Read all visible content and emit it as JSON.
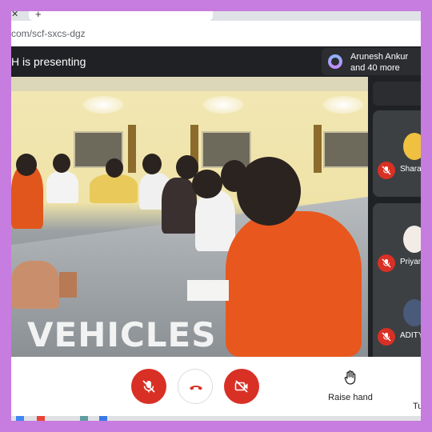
{
  "browser": {
    "url": "com/scf-sxcs-dgz"
  },
  "meet": {
    "presenting_text": "H is presenting",
    "participants_chip": {
      "name": "Arunesh Ankur",
      "more": "and 40 more"
    }
  },
  "presentation": {
    "watermark": "VEHICLES"
  },
  "sidebar": {
    "tiles": [
      {
        "name": "Sharan",
        "muted": true
      },
      {
        "name": "Priyans",
        "muted": true
      },
      {
        "name": "ADITYA",
        "muted": true
      }
    ]
  },
  "controls": {
    "raise_hand_label": "Raise hand",
    "turn_label": "Tu"
  },
  "colors": {
    "border": "#c77ce0",
    "meet_dark": "#202124",
    "danger": "#d93025"
  }
}
